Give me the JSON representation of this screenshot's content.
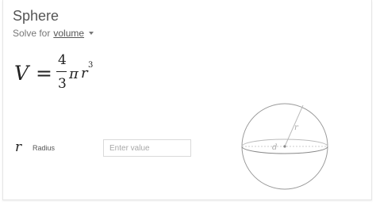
{
  "card": {
    "title": "Sphere",
    "solve_prefix": "Solve for",
    "solve_value": "volume"
  },
  "formula": {
    "lhs": "V",
    "equals": "=",
    "numerator": "4",
    "denominator": "3",
    "pi": "π",
    "r": "r",
    "exponent": "3"
  },
  "variables": [
    {
      "symbol": "r",
      "label": "Radius",
      "placeholder": "Enter value",
      "value": ""
    }
  ],
  "diagram": {
    "radius_label": "r",
    "diameter_label": "d"
  }
}
